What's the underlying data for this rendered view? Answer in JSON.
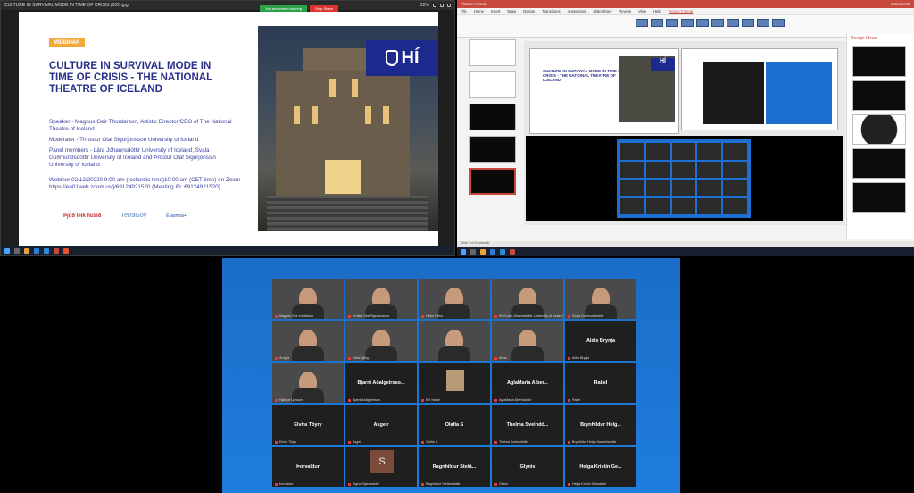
{
  "viewer": {
    "title": "CULTURE IN SURVIVAL MODE IN TIME OF CRISIS (002).jpg",
    "badge": "WEBINAR",
    "headline": "CULTURE IN SURVIVAL MODE IN TIME OF CRISIS  - THE NATIONAL THEATRE OF ICELAND",
    "speaker": "Speaker - Magnus Geir Thordarson, Artistic Director/CEO of The National Theatre of Iceland",
    "moderator": "Moderator - Throstur Olaf Sigurjonsson University of Iceland",
    "panel": "Panel members - Lára Jóhannsdóttir University of Iceland, Svala Guðmundsdóttir University of Iceland and Þröstur Olaf Sigurjónssin University of Iceland",
    "webinar_info": "Webiner 02/12/20220 9:00 am (Icelandic time)10:00 am (CET time) on Zoom https://eu01web.zoom.us/j/69124921520 (Meeting ID: 69124921520)",
    "share_label": "You are screen sharing",
    "stop_label": "Stop Share",
    "logo_text": "HÍ",
    "partner_logo_1": "Þjóð leik húsið",
    "partner_logo_2": "TerraGov",
    "partner_logo_3": "Erasmus+",
    "zoom_pct": "22%"
  },
  "ppt": {
    "app_title": "Picture Format",
    "comments_label": "Comments",
    "tabs": [
      "File",
      "Home",
      "Insert",
      "Draw",
      "Design",
      "Transitions",
      "Animations",
      "Slide Show",
      "Review",
      "View",
      "Help",
      "Picture Format"
    ],
    "active_tab": "Picture Format",
    "design_ideas": "Design Ideas",
    "status": "Slide 5 of 5   Icelandic",
    "slide_title": "CULTURE IN SURVIVAL MODE IN TIME OF CRISIS - THE NATIONAL THEATRE OF ICELAND",
    "slide_logo": "HÍ"
  },
  "zoom": {
    "participants": [
      {
        "name": "Magnús Geir Þórðarson",
        "kind": "video",
        "bg": "t-bg1"
      },
      {
        "name": "Þröstur Olaf Sigurjónsson",
        "kind": "video",
        "bg": "t-bg2"
      },
      {
        "name": "Hildur Pétur",
        "kind": "video",
        "bg": "t-bg3"
      },
      {
        "name": "Prof Lára Jóhannsdóttir, University of Iceland",
        "kind": "video",
        "bg": "t-bg4"
      },
      {
        "name": "Svala Guðmundsdóttir",
        "kind": "video",
        "bg": "t-bg5"
      },
      {
        "name": "Arngeir",
        "kind": "video",
        "bg": "t-bg6"
      },
      {
        "name": "Edda Björg",
        "kind": "video",
        "bg": "t-bg7"
      },
      {
        "name": "",
        "kind": "video",
        "bg": "t-bg8"
      },
      {
        "name": "Anna",
        "kind": "video",
        "bg": "t-bg9"
      },
      {
        "label": "Aldís Brynja",
        "name": "Aldís Brynja",
        "kind": "text"
      },
      {
        "name": "Hjálmar Ljósson",
        "kind": "video",
        "bg": "t-bg2"
      },
      {
        "label": "Bjarni Aðalgeirsso...",
        "name": "Bjarni Aðalgeirsson",
        "kind": "text"
      },
      {
        "name": "Elli Yahan",
        "kind": "thumb"
      },
      {
        "label": "AglaMaría Alber...",
        "name": "AglaMaría Albertsdóttir",
        "kind": "text"
      },
      {
        "label": "Rakel",
        "name": "Rakel",
        "kind": "text"
      },
      {
        "label": "Elvíra Töyry",
        "name": "Elvíra Töyry",
        "kind": "text"
      },
      {
        "label": "Ásgeir",
        "name": "Ásgeir",
        "kind": "text"
      },
      {
        "label": "Olafía S",
        "name": "Olafía S",
        "kind": "text"
      },
      {
        "label": "Thelma Sveindó...",
        "name": "Thelma Sveinsdóttir",
        "kind": "text"
      },
      {
        "label": "Brynhildur Helg...",
        "name": "Brynhildur Helga Samúelsdóttir",
        "kind": "text"
      },
      {
        "label": "Þorvaldur",
        "name": "Þorvaldur",
        "kind": "text"
      },
      {
        "name": "Sigrún Bjarnadóttir",
        "kind": "avatar",
        "initial": "S"
      },
      {
        "label": "Ragnhildur Stefá...",
        "name": "Ragnhildur Stefánsdóttir",
        "kind": "text"
      },
      {
        "label": "Glynis",
        "name": "Glynis",
        "kind": "text"
      },
      {
        "label": "Helga Kristín Ge...",
        "name": "Helga Kristín Geirsdóttir",
        "kind": "text"
      }
    ]
  }
}
